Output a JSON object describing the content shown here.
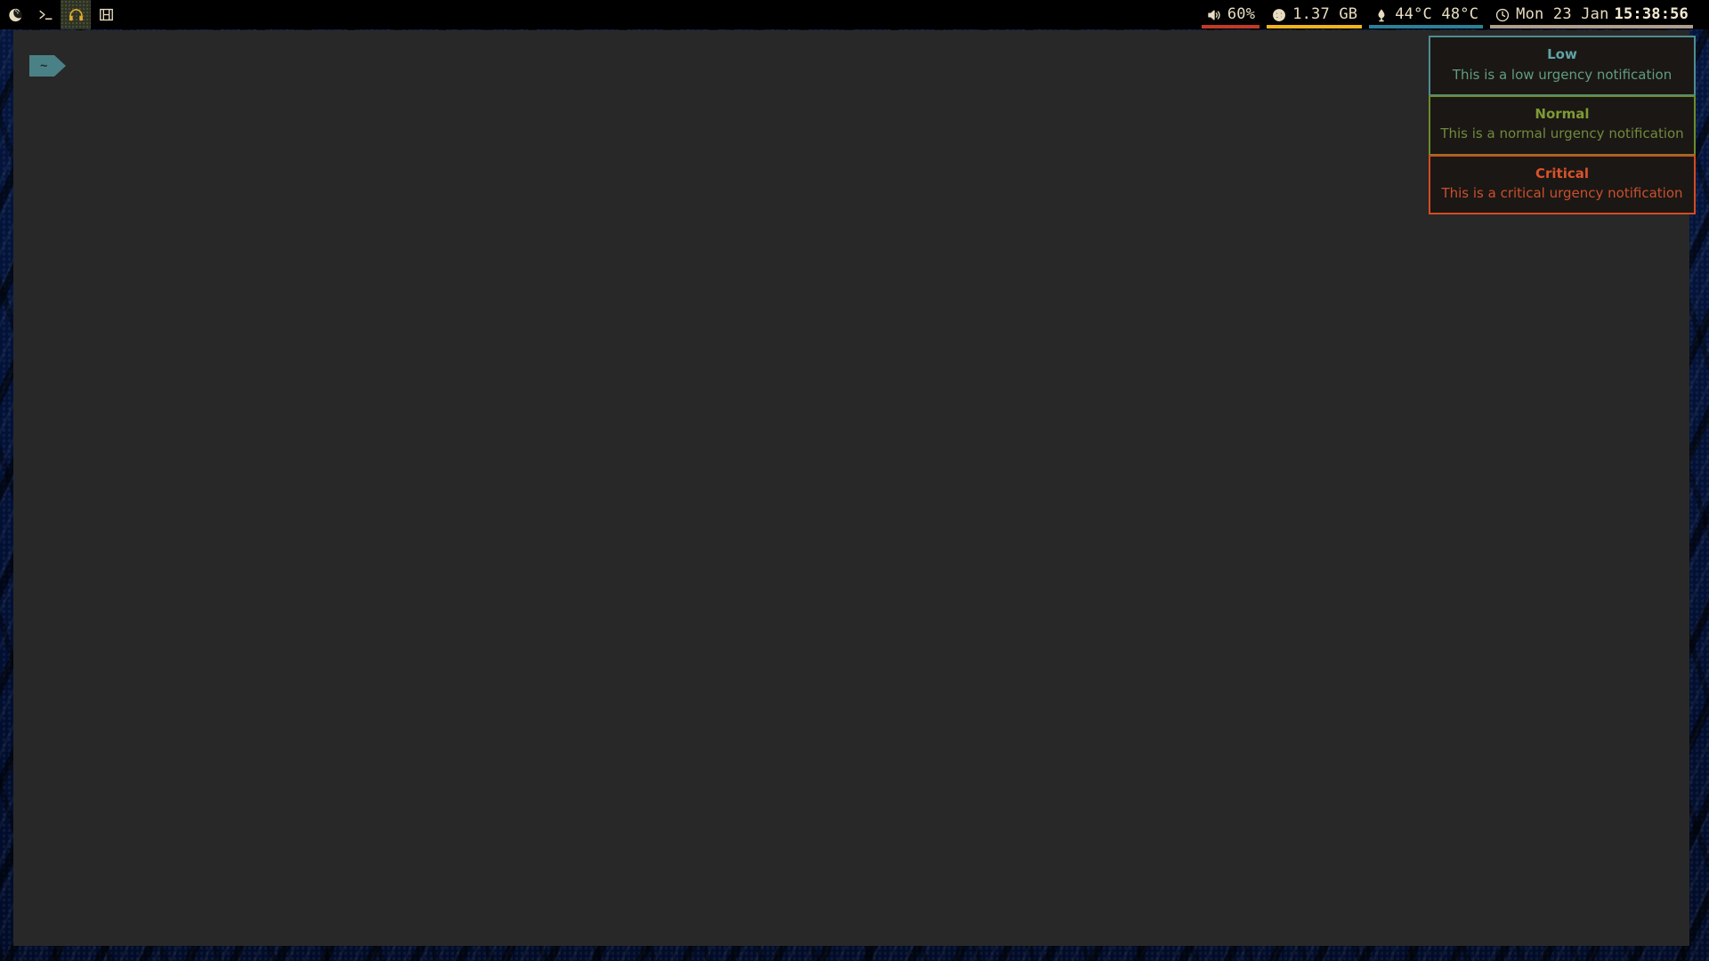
{
  "bar": {
    "workspaces": [
      {
        "name": "workspace-firefox",
        "icon": "firefox-icon",
        "active": false
      },
      {
        "name": "workspace-terminal",
        "icon": "terminal-prompt-icon",
        "active": false
      },
      {
        "name": "workspace-music",
        "icon": "headphones-icon",
        "active": true
      },
      {
        "name": "workspace-video",
        "icon": "film-strip-icon",
        "active": false
      }
    ],
    "status": [
      {
        "name": "volume",
        "icon": "speaker-volume-icon",
        "value": "60%",
        "underline": "#c03a24"
      },
      {
        "name": "memory",
        "icon": "memory-gauge-icon",
        "value": "1.37 GB",
        "underline": "#efb41a"
      },
      {
        "name": "temperature",
        "icon": "thermometer-icon",
        "value": "44°C 48°C",
        "underline": "#2c8096"
      },
      {
        "name": "clock",
        "icon": "clock-icon",
        "date": "Mon 23 Jan",
        "time": "15:38:56",
        "underline": "#ad9e8c"
      }
    ]
  },
  "terminal": {
    "prompt_segment": "~"
  },
  "notifications": [
    {
      "urgency": "low",
      "title": "Low",
      "body": "This is a low urgency notification",
      "border": "#4e8c92",
      "title_color": "#5fa3a8",
      "body_color": "#5f9e7e",
      "background": "#1b1714"
    },
    {
      "urgency": "normal",
      "title": "Normal",
      "body": "This is a normal urgency notification",
      "border": "#6b8c2a",
      "title_color": "#7e9b33",
      "body_color": "#6f8a3e",
      "background": "#1b1714"
    },
    {
      "urgency": "critical",
      "title": "Critical",
      "body": "This is a critical urgency notification",
      "border": "#d34b22",
      "title_color": "#d9532b",
      "body_color": "#c9502f",
      "background": "#1b1714"
    }
  ]
}
